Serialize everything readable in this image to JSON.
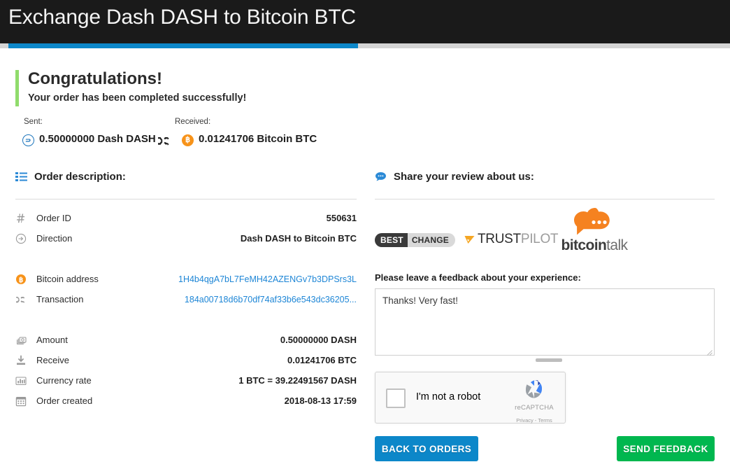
{
  "header": {
    "title": "Exchange Dash DASH to Bitcoin BTC",
    "progress_percent": 48,
    "bar_color": "#0c87c9",
    "background": "#1a1a1a"
  },
  "congratulations": {
    "title": "Congratulations!",
    "subtitle": "Your order has been completed successfully!",
    "accent_color": "#90dc6c"
  },
  "exchange": {
    "sent_label": "Sent:",
    "received_label": "Received:",
    "sent_amount": "0.50000000 Dash DASH",
    "received_amount": "0.01241706 Bitcoin BTC",
    "sent_icon": "dash-coin-icon",
    "received_icon": "bitcoin-coin-icon",
    "swap_icon": "shuffle-icon",
    "bitcoin_color": "#f7931a",
    "dash_color": "#1c75bc"
  },
  "order": {
    "section_title": "Order description:",
    "section_icon": "list-icon",
    "rows": [
      {
        "icon": "hash-icon",
        "label": "Order ID",
        "value": "550631",
        "link": false
      },
      {
        "icon": "arrow-circle-right-icon",
        "label": "Direction",
        "value": "Dash DASH to Bitcoin BTC",
        "link": false
      },
      {
        "icon": "bitcoin-icon",
        "label": "Bitcoin address",
        "value": "1H4b4qgA7bL7FeMH42AZENGv7b3DPSrs3L",
        "link": true
      },
      {
        "icon": "shuffle-icon",
        "label": "Transaction",
        "value": "184a00718d6b70df74af33b6e543dc36205...",
        "link": true
      },
      {
        "icon": "money-icon",
        "label": "Amount",
        "value": "0.50000000 DASH",
        "link": false
      },
      {
        "icon": "download-icon",
        "label": "Receive",
        "value": "0.01241706 BTC",
        "link": false
      },
      {
        "icon": "bar-chart-icon",
        "label": "Currency rate",
        "value": "1 BTC = 39.22491567 DASH",
        "link": false
      },
      {
        "icon": "calendar-icon",
        "label": "Order created",
        "value": "2018-08-13 17:59",
        "link": false
      }
    ],
    "link_color": "#1e86d6"
  },
  "review": {
    "section_title": "Share your review about us:",
    "section_icon": "comment-icon",
    "logos": {
      "bestchange_first": "BEST",
      "bestchange_second": "CHANGE",
      "trustpilot_first": "TRUST",
      "trustpilot_second": "PILOT",
      "bitcointalk_first": "bitcoin",
      "bitcointalk_second": "talk",
      "trustpilot_star_color": "#f5a623",
      "bitcointalk_color": "#f58220"
    },
    "feedback_label": "Please leave a feedback about your experience:",
    "feedback_value": "Thanks! Very fast!",
    "feedback_placeholder": "Please leave a feedback about your experience"
  },
  "recaptcha": {
    "checkbox_label": "I'm not a robot",
    "brand": "reCAPTCHA",
    "legal": "Privacy - Terms",
    "checked": false
  },
  "actions": {
    "back_label": "BACK TO ORDERS",
    "send_label": "SEND FEEDBACK",
    "back_color": "#0c87c9",
    "send_color": "#00b74f"
  }
}
